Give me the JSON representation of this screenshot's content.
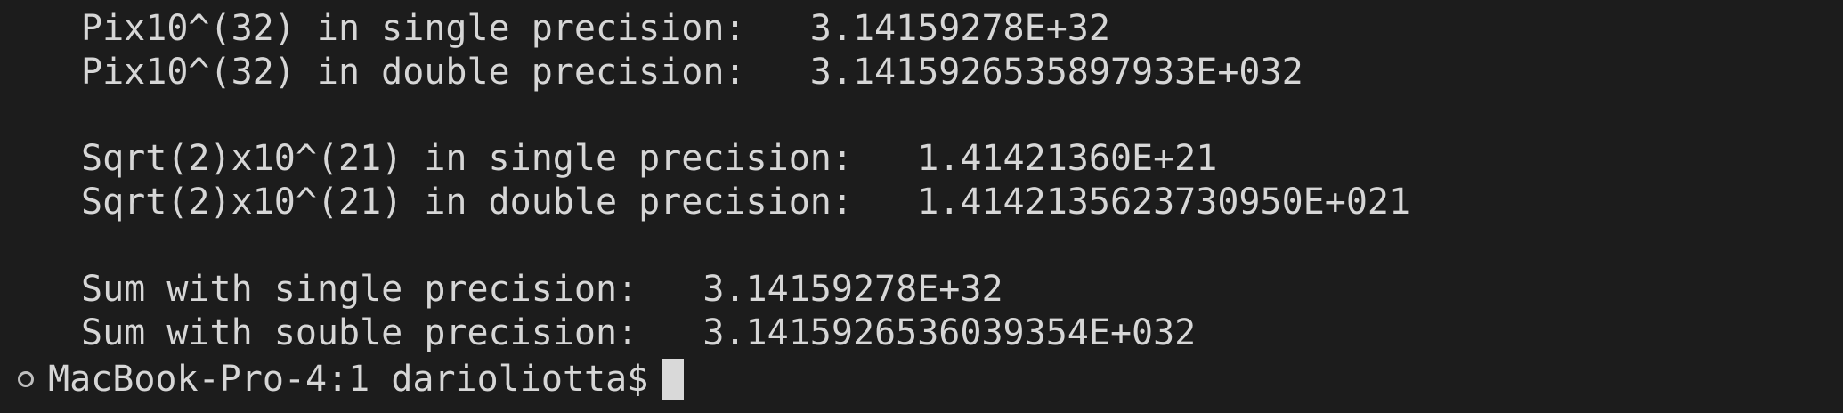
{
  "terminal": {
    "lines": [
      "Pix10^(32) in single precision:   3.14159278E+32",
      "Pix10^(32) in double precision:   3.1415926535897933E+032",
      "",
      "Sqrt(2)x10^(21) in single precision:   1.41421360E+21",
      "Sqrt(2)x10^(21) in double precision:   1.4142135623730950E+021",
      "",
      "Sum with single precision:   3.14159278E+32",
      "Sum with souble precision:   3.1415926536039354E+032"
    ],
    "prompt": "MacBook-Pro-4:1 darioliotta$"
  },
  "colors": {
    "background": "#1c1c1c",
    "text": "#d6d6d6",
    "cursor": "#d9d9d9",
    "indicator": "#bdbdbd"
  }
}
